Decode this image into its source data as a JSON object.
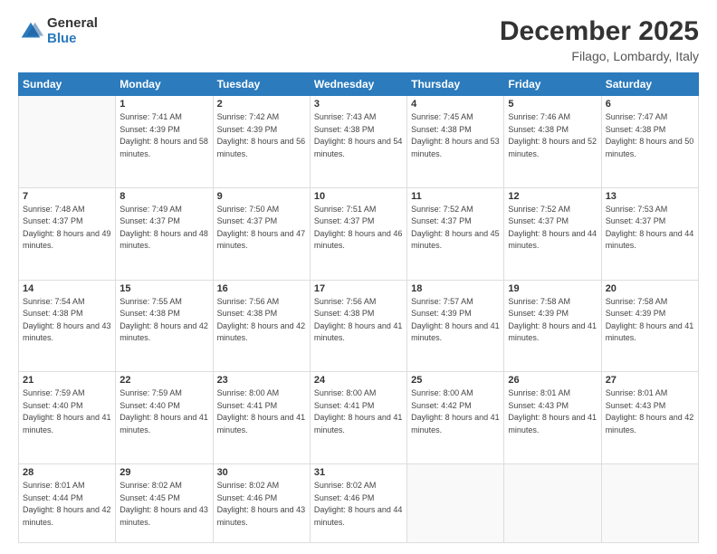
{
  "logo": {
    "general": "General",
    "blue": "Blue"
  },
  "header": {
    "month": "December 2025",
    "location": "Filago, Lombardy, Italy"
  },
  "weekdays": [
    "Sunday",
    "Monday",
    "Tuesday",
    "Wednesday",
    "Thursday",
    "Friday",
    "Saturday"
  ],
  "weeks": [
    [
      {
        "day": "",
        "sunrise": "",
        "sunset": "",
        "daylight": ""
      },
      {
        "day": "1",
        "sunrise": "Sunrise: 7:41 AM",
        "sunset": "Sunset: 4:39 PM",
        "daylight": "Daylight: 8 hours and 58 minutes."
      },
      {
        "day": "2",
        "sunrise": "Sunrise: 7:42 AM",
        "sunset": "Sunset: 4:39 PM",
        "daylight": "Daylight: 8 hours and 56 minutes."
      },
      {
        "day": "3",
        "sunrise": "Sunrise: 7:43 AM",
        "sunset": "Sunset: 4:38 PM",
        "daylight": "Daylight: 8 hours and 54 minutes."
      },
      {
        "day": "4",
        "sunrise": "Sunrise: 7:45 AM",
        "sunset": "Sunset: 4:38 PM",
        "daylight": "Daylight: 8 hours and 53 minutes."
      },
      {
        "day": "5",
        "sunrise": "Sunrise: 7:46 AM",
        "sunset": "Sunset: 4:38 PM",
        "daylight": "Daylight: 8 hours and 52 minutes."
      },
      {
        "day": "6",
        "sunrise": "Sunrise: 7:47 AM",
        "sunset": "Sunset: 4:38 PM",
        "daylight": "Daylight: 8 hours and 50 minutes."
      }
    ],
    [
      {
        "day": "7",
        "sunrise": "Sunrise: 7:48 AM",
        "sunset": "Sunset: 4:37 PM",
        "daylight": "Daylight: 8 hours and 49 minutes."
      },
      {
        "day": "8",
        "sunrise": "Sunrise: 7:49 AM",
        "sunset": "Sunset: 4:37 PM",
        "daylight": "Daylight: 8 hours and 48 minutes."
      },
      {
        "day": "9",
        "sunrise": "Sunrise: 7:50 AM",
        "sunset": "Sunset: 4:37 PM",
        "daylight": "Daylight: 8 hours and 47 minutes."
      },
      {
        "day": "10",
        "sunrise": "Sunrise: 7:51 AM",
        "sunset": "Sunset: 4:37 PM",
        "daylight": "Daylight: 8 hours and 46 minutes."
      },
      {
        "day": "11",
        "sunrise": "Sunrise: 7:52 AM",
        "sunset": "Sunset: 4:37 PM",
        "daylight": "Daylight: 8 hours and 45 minutes."
      },
      {
        "day": "12",
        "sunrise": "Sunrise: 7:52 AM",
        "sunset": "Sunset: 4:37 PM",
        "daylight": "Daylight: 8 hours and 44 minutes."
      },
      {
        "day": "13",
        "sunrise": "Sunrise: 7:53 AM",
        "sunset": "Sunset: 4:37 PM",
        "daylight": "Daylight: 8 hours and 44 minutes."
      }
    ],
    [
      {
        "day": "14",
        "sunrise": "Sunrise: 7:54 AM",
        "sunset": "Sunset: 4:38 PM",
        "daylight": "Daylight: 8 hours and 43 minutes."
      },
      {
        "day": "15",
        "sunrise": "Sunrise: 7:55 AM",
        "sunset": "Sunset: 4:38 PM",
        "daylight": "Daylight: 8 hours and 42 minutes."
      },
      {
        "day": "16",
        "sunrise": "Sunrise: 7:56 AM",
        "sunset": "Sunset: 4:38 PM",
        "daylight": "Daylight: 8 hours and 42 minutes."
      },
      {
        "day": "17",
        "sunrise": "Sunrise: 7:56 AM",
        "sunset": "Sunset: 4:38 PM",
        "daylight": "Daylight: 8 hours and 41 minutes."
      },
      {
        "day": "18",
        "sunrise": "Sunrise: 7:57 AM",
        "sunset": "Sunset: 4:39 PM",
        "daylight": "Daylight: 8 hours and 41 minutes."
      },
      {
        "day": "19",
        "sunrise": "Sunrise: 7:58 AM",
        "sunset": "Sunset: 4:39 PM",
        "daylight": "Daylight: 8 hours and 41 minutes."
      },
      {
        "day": "20",
        "sunrise": "Sunrise: 7:58 AM",
        "sunset": "Sunset: 4:39 PM",
        "daylight": "Daylight: 8 hours and 41 minutes."
      }
    ],
    [
      {
        "day": "21",
        "sunrise": "Sunrise: 7:59 AM",
        "sunset": "Sunset: 4:40 PM",
        "daylight": "Daylight: 8 hours and 41 minutes."
      },
      {
        "day": "22",
        "sunrise": "Sunrise: 7:59 AM",
        "sunset": "Sunset: 4:40 PM",
        "daylight": "Daylight: 8 hours and 41 minutes."
      },
      {
        "day": "23",
        "sunrise": "Sunrise: 8:00 AM",
        "sunset": "Sunset: 4:41 PM",
        "daylight": "Daylight: 8 hours and 41 minutes."
      },
      {
        "day": "24",
        "sunrise": "Sunrise: 8:00 AM",
        "sunset": "Sunset: 4:41 PM",
        "daylight": "Daylight: 8 hours and 41 minutes."
      },
      {
        "day": "25",
        "sunrise": "Sunrise: 8:00 AM",
        "sunset": "Sunset: 4:42 PM",
        "daylight": "Daylight: 8 hours and 41 minutes."
      },
      {
        "day": "26",
        "sunrise": "Sunrise: 8:01 AM",
        "sunset": "Sunset: 4:43 PM",
        "daylight": "Daylight: 8 hours and 41 minutes."
      },
      {
        "day": "27",
        "sunrise": "Sunrise: 8:01 AM",
        "sunset": "Sunset: 4:43 PM",
        "daylight": "Daylight: 8 hours and 42 minutes."
      }
    ],
    [
      {
        "day": "28",
        "sunrise": "Sunrise: 8:01 AM",
        "sunset": "Sunset: 4:44 PM",
        "daylight": "Daylight: 8 hours and 42 minutes."
      },
      {
        "day": "29",
        "sunrise": "Sunrise: 8:02 AM",
        "sunset": "Sunset: 4:45 PM",
        "daylight": "Daylight: 8 hours and 43 minutes."
      },
      {
        "day": "30",
        "sunrise": "Sunrise: 8:02 AM",
        "sunset": "Sunset: 4:46 PM",
        "daylight": "Daylight: 8 hours and 43 minutes."
      },
      {
        "day": "31",
        "sunrise": "Sunrise: 8:02 AM",
        "sunset": "Sunset: 4:46 PM",
        "daylight": "Daylight: 8 hours and 44 minutes."
      },
      {
        "day": "",
        "sunrise": "",
        "sunset": "",
        "daylight": ""
      },
      {
        "day": "",
        "sunrise": "",
        "sunset": "",
        "daylight": ""
      },
      {
        "day": "",
        "sunrise": "",
        "sunset": "",
        "daylight": ""
      }
    ]
  ]
}
